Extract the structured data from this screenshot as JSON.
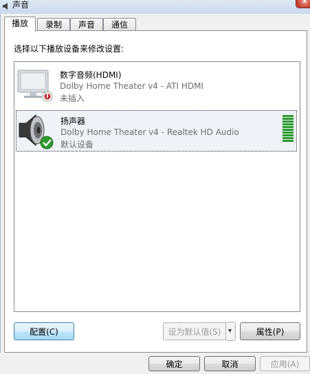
{
  "window": {
    "title": "声音",
    "close_glyph": "x"
  },
  "tabs": [
    {
      "label": "播放",
      "active": true
    },
    {
      "label": "录制",
      "active": false
    },
    {
      "label": "声音",
      "active": false
    },
    {
      "label": "通信",
      "active": false
    }
  ],
  "instruction": "选择以下播放设备来修改设置:",
  "devices": [
    {
      "name": "数字音频(HDMI)",
      "description": "Dolby Home Theater v4 - ATI HDMI",
      "status": "未插入",
      "icon": "monitor-icon",
      "badge": "unplugged-badge-icon",
      "selected": false
    },
    {
      "name": "扬声器",
      "description": "Dolby Home Theater v4 - Realtek HD Audio",
      "status": "默认设备",
      "icon": "speaker-icon",
      "badge": "default-check-icon",
      "selected": true,
      "level_fraction": 1.0
    }
  ],
  "buttons": {
    "configure": "配置(C)",
    "set_default": "设为默认值(S)",
    "properties": "属性(P)",
    "ok": "确定",
    "cancel": "取消",
    "apply": "应用(A)"
  },
  "colors": {
    "meter": "#2d9a2d",
    "default_button_border": "#3c7fb1"
  }
}
